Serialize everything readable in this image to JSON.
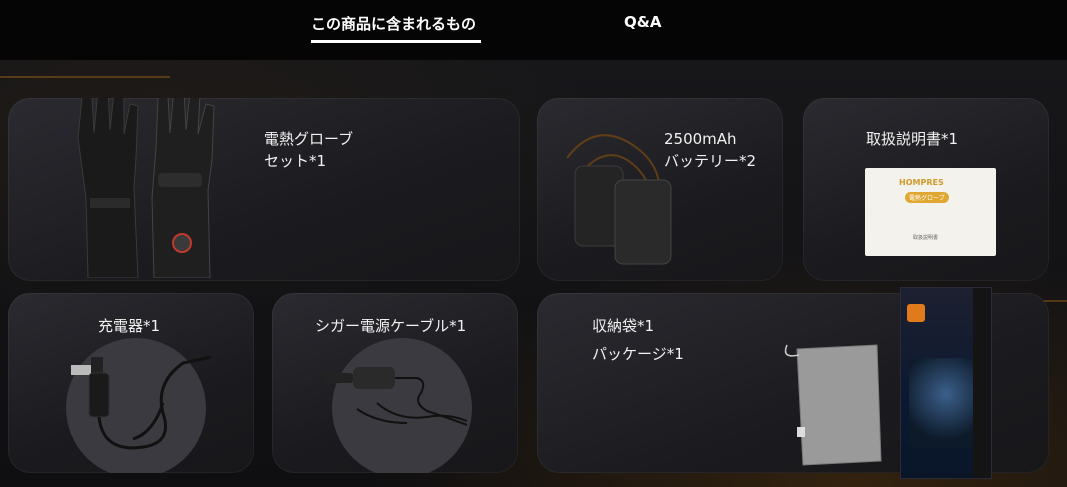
{
  "tabs": [
    {
      "label": "この商品に含まれるもの",
      "active": true
    },
    {
      "label": "Q&A",
      "active": false
    }
  ],
  "items": {
    "gloves": {
      "line1": "電熱グローブ",
      "line2": "セット*1"
    },
    "battery": {
      "line1": "2500mAh",
      "line2": "バッテリー*2"
    },
    "manual": {
      "line1": "取扱説明書*1",
      "brand": "HOMPRES",
      "badge": "電熱グローブ",
      "caption": "取扱説明書"
    },
    "charger": {
      "line1": "充電器*1"
    },
    "cable": {
      "line1": "シガー電源ケーブル*1"
    },
    "bag": {
      "line1": "収納袋*1",
      "line2": "パッケージ*1"
    }
  },
  "colors": {
    "accent_orange": "#c8781a",
    "card": "#222227",
    "background": "#111113"
  }
}
